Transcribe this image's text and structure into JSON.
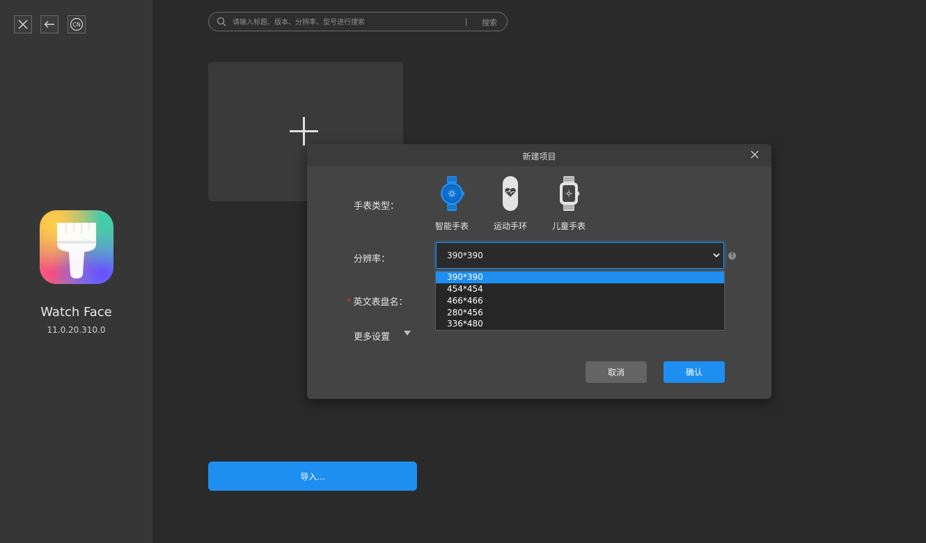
{
  "sidebar": {
    "lang_badge": "CN",
    "app_name": "Watch Face",
    "app_version": "11.0.20.310.0"
  },
  "search": {
    "placeholder": "请输入标题、版本、分辨率、型号进行搜索",
    "button": "搜索"
  },
  "import_button": "导入...",
  "dialog": {
    "title": "新建项目",
    "watch_type_label": "手表类型：",
    "watch_types": [
      {
        "label": "智能手表",
        "selected": true
      },
      {
        "label": "运动手环",
        "selected": false
      },
      {
        "label": "儿童手表",
        "selected": false
      }
    ],
    "resolution_label": "分辨率：",
    "resolution_value": "390*390",
    "resolution_options": [
      "390*390",
      "454*454",
      "466*466",
      "280*456",
      "336*480"
    ],
    "name_required_mark": "*",
    "name_label": "英文表盘名：",
    "more_settings_label": "更多设置",
    "info_glyph": "!",
    "cancel_button": "取消",
    "confirm_button": "确认"
  },
  "colors": {
    "accent": "#1e8ef0",
    "background": "#2a2a2a",
    "sidebar": "#363636",
    "dialog": "#444444"
  }
}
